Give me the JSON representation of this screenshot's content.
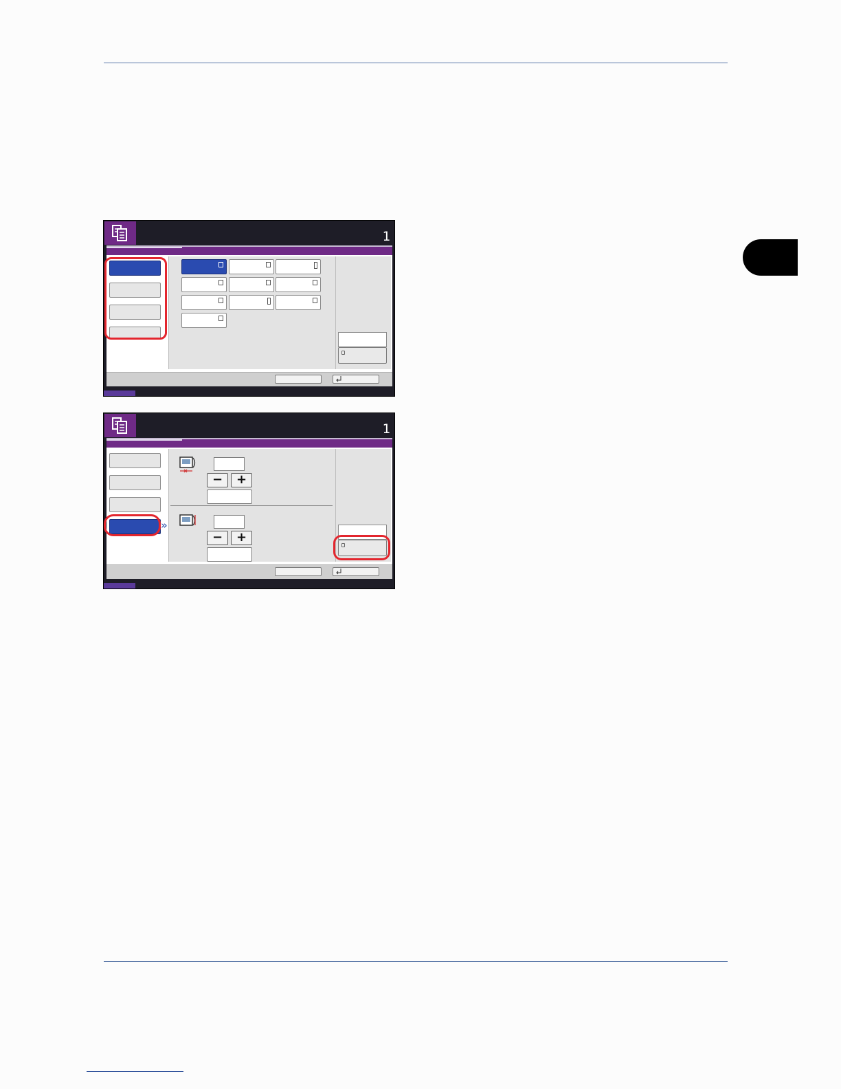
{
  "screens": [
    {
      "copy_count": "1",
      "icon": "copy-icon"
    },
    {
      "copy_count": "1",
      "icon": "copy-icon",
      "steppers": [
        {
          "minus_symbol": "−",
          "plus_symbol": "+"
        },
        {
          "minus_symbol": "−",
          "plus_symbol": "+"
        }
      ]
    }
  ],
  "colors": {
    "accent_purple": "#6f2a86",
    "selected_blue": "#2a4bb0",
    "highlight_red": "#e3262e",
    "chapter_tab": "#000000",
    "rule_blue": "#5a77a8"
  }
}
